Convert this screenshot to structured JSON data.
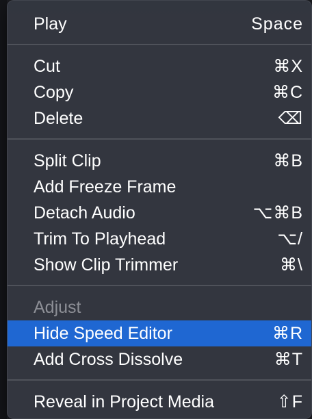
{
  "menu": {
    "items": [
      {
        "label": "Play",
        "shortcut": "Space"
      },
      {
        "label": "Cut",
        "shortcut": "⌘X"
      },
      {
        "label": "Copy",
        "shortcut": "⌘C"
      },
      {
        "label": "Delete",
        "shortcut": "⌫"
      },
      {
        "label": "Split Clip",
        "shortcut": "⌘B"
      },
      {
        "label": "Add Freeze Frame",
        "shortcut": ""
      },
      {
        "label": "Detach Audio",
        "shortcut": "⌥⌘B"
      },
      {
        "label": "Trim To Playhead",
        "shortcut": "⌥/"
      },
      {
        "label": "Show Clip Trimmer",
        "shortcut": "⌘\\"
      },
      {
        "label": "Adjust",
        "shortcut": ""
      },
      {
        "label": "Hide Speed Editor",
        "shortcut": "⌘R"
      },
      {
        "label": "Add Cross Dissolve",
        "shortcut": "⌘T"
      },
      {
        "label": "Reveal in Project Media",
        "shortcut": "⇧F"
      }
    ]
  },
  "colors": {
    "highlight": "#1f67d2",
    "menu_background": "#343740",
    "text": "#ffffff",
    "disabled_text": "#8d8f96"
  }
}
